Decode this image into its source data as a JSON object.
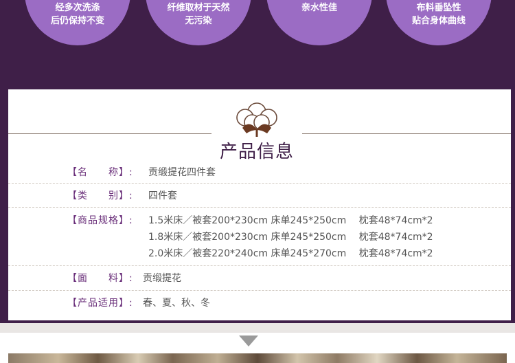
{
  "features": [
    {
      "line1": "经多次洗涤",
      "line2": "后仍保持不变"
    },
    {
      "line1": "纤维取材于天然",
      "line2": "无污染"
    },
    {
      "line1": "亲水性佳",
      "line2": ""
    },
    {
      "line1": "布料垂坠性",
      "line2": "贴合身体曲线"
    }
  ],
  "product_info": {
    "title": "产品信息",
    "name": {
      "label": "【名　　称】:",
      "value": "贡缎提花四件套"
    },
    "category": {
      "label": "【类　　别】:",
      "value": "四件套"
    },
    "specs": {
      "label": "【商品规格】:",
      "lines": [
        "1.5米床／被套200*230cm 床单245*250cm　 枕套48*74cm*2",
        "1.8米床／被套200*230cm 床单245*250cm　 枕套48*74cm*2",
        "2.0米床／被套220*240cm 床单245*270cm　 枕套48*74cm*2"
      ]
    },
    "fabric": {
      "label": "【面　　料】:",
      "value": "贡缎提花"
    },
    "season": {
      "label": "【产品适用】:",
      "value": "春、夏、秋、冬"
    }
  },
  "colors": {
    "purple_dark": "#3f1f48",
    "purple_circle": "#9b6cc4",
    "label_purple": "#6a2f7a"
  },
  "icons": {
    "section_icon": "cotton-flower-icon",
    "divider": "arrow-down-icon"
  }
}
